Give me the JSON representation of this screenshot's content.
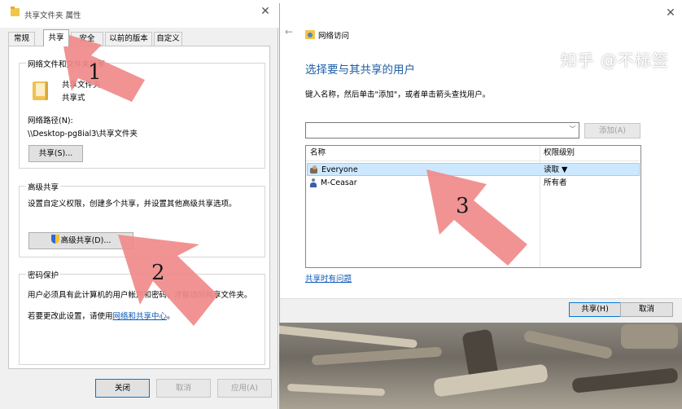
{
  "props_dialog": {
    "title": "共享文件夹 属性",
    "tabs": [
      {
        "label": "常规"
      },
      {
        "label": "共享",
        "active": true
      },
      {
        "label": "安全"
      },
      {
        "label": "以前的版本"
      },
      {
        "label": "自定义"
      }
    ],
    "net_group": {
      "label": "网络文件和文件夹共享",
      "folder_name": "共享文件夹",
      "folder_status": "共享式",
      "path_label": "网络路径(N):",
      "path_value": "\\\\Desktop-pg8ial3\\共享文件夹",
      "share_button": "共享(S)..."
    },
    "adv_group": {
      "label": "高级共享",
      "desc": "设置自定义权限，创建多个共享，并设置其他高级共享选项。",
      "button": "高级共享(D)..."
    },
    "pwd_group": {
      "label": "密码保护",
      "desc": "用户必须具有此计算机的用户帐户和密码，才能访问共享文件夹。",
      "change_prefix": "若要更改此设置，请使用",
      "change_link": "网络和共享中心",
      "change_suffix": "。"
    },
    "buttons": {
      "close": "关闭",
      "cancel": "取消",
      "apply": "应用(A)"
    }
  },
  "share_dialog": {
    "title": "网络访问",
    "heading": "选择要与其共享的用户",
    "instruction": "键入名称，然后单击\"添加\"，或者单击箭头查找用户。",
    "input_value": "",
    "add_button": "添加(A)",
    "columns": {
      "name": "名称",
      "level": "权限级别"
    },
    "rows": [
      {
        "name": "Everyone",
        "level": "读取 ▼",
        "selected": true,
        "icon": "group-icon"
      },
      {
        "name": "M-Ceasar",
        "level": "所有者",
        "selected": false,
        "icon": "user-icon"
      }
    ],
    "trouble_link": "共享时有问题",
    "buttons": {
      "share": "共享(H)",
      "cancel": "取消"
    }
  },
  "annotations": {
    "labels": [
      "1",
      "2",
      "3"
    ],
    "arrow_color": "#f08a8a"
  },
  "watermark": "知乎 @不标签"
}
